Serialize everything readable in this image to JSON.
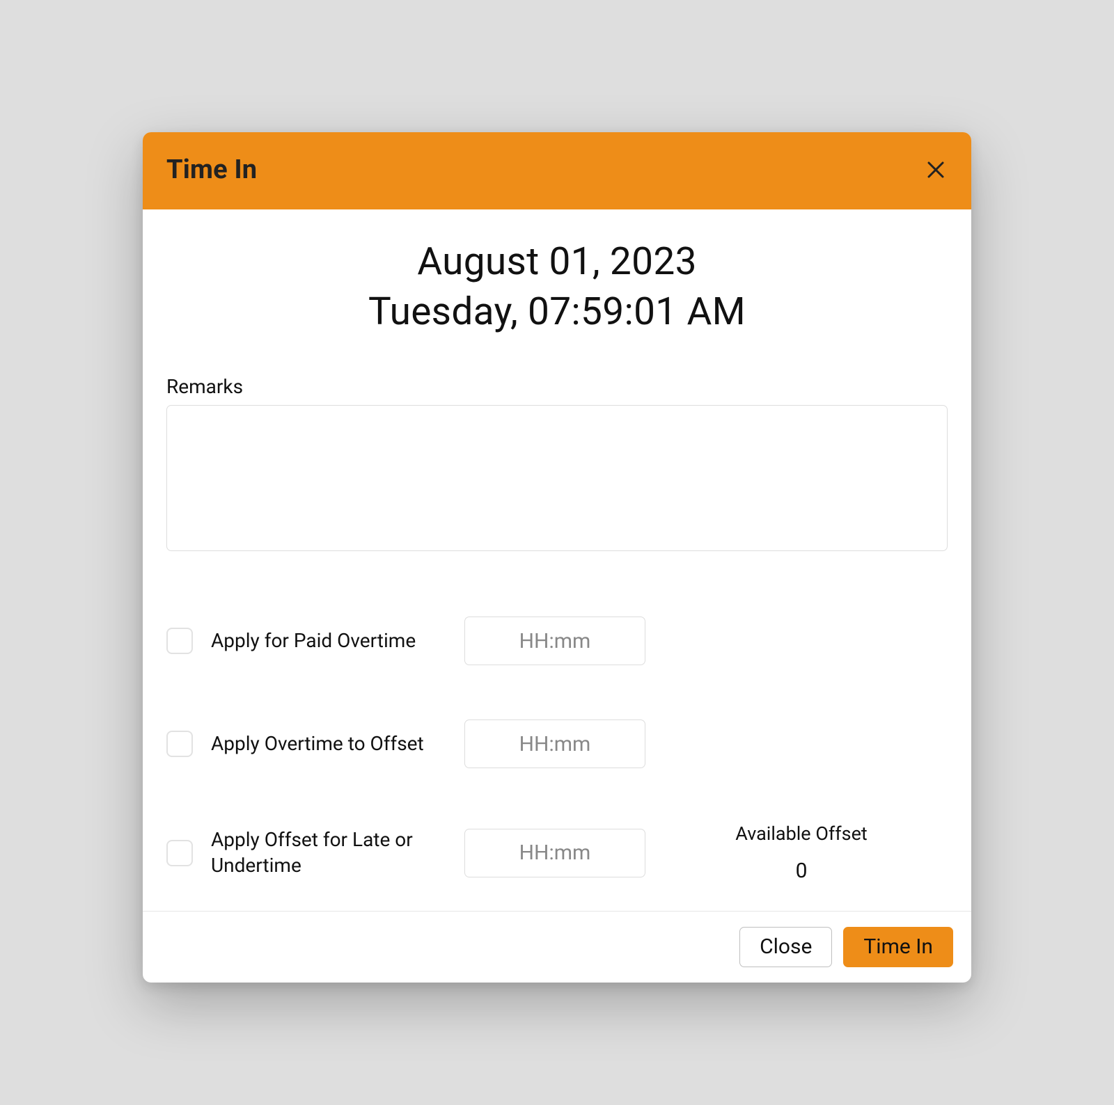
{
  "modal": {
    "title": "Time In",
    "date_line": "August 01, 2023",
    "day_time_line": "Tuesday, 07:59:01 AM",
    "remarks_label": "Remarks",
    "remarks_value": "",
    "options": [
      {
        "label": "Apply for Paid Overtime",
        "placeholder": "HH:mm",
        "value": ""
      },
      {
        "label": "Apply Overtime to Offset",
        "placeholder": "HH:mm",
        "value": ""
      },
      {
        "label": "Apply Offset for Late or Undertime",
        "placeholder": "HH:mm",
        "value": ""
      }
    ],
    "available_offset_label": "Available Offset",
    "available_offset_value": "0",
    "buttons": {
      "close": "Close",
      "submit": "Time In"
    },
    "colors": {
      "accent": "#ee8d18"
    }
  }
}
